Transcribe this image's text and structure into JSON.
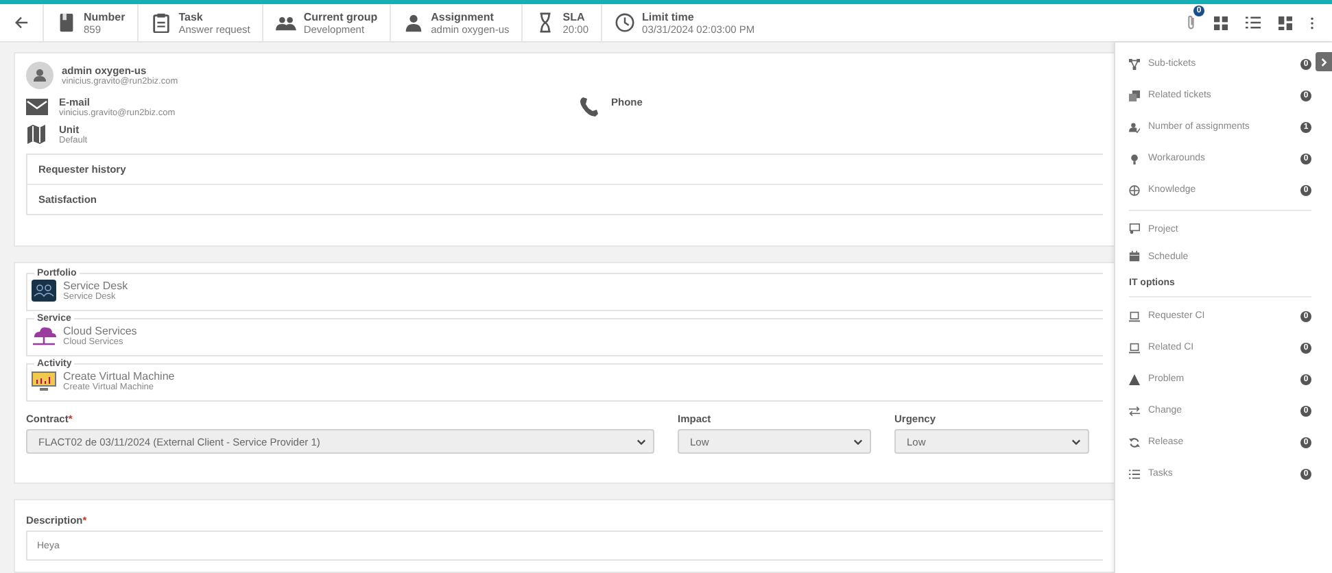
{
  "header": {
    "items": [
      {
        "label": "Number",
        "value": "859"
      },
      {
        "label": "Task",
        "value": "Answer request"
      },
      {
        "label": "Current group",
        "value": "Development"
      },
      {
        "label": "Assignment",
        "value": "admin oxygen-us"
      },
      {
        "label": "SLA",
        "value": "20:00"
      },
      {
        "label": "Limit time",
        "value": "03/31/2024 02:03:00 PM"
      }
    ],
    "attachment_count": "0"
  },
  "requester": {
    "name": "admin oxygen-us",
    "email": "vinicius.gravito@run2biz.com"
  },
  "contact": [
    {
      "label": "E-mail",
      "value": "vinicius.gravito@run2biz.com"
    },
    {
      "label": "Phone"
    },
    {
      "label": "Unit",
      "value": "Default"
    }
  ],
  "requester_sections": [
    "Requester history",
    "Satisfaction"
  ],
  "catalog": [
    {
      "label": "Portfolio",
      "title": "Service Desk",
      "subtitle": "Service Desk"
    },
    {
      "label": "Service",
      "title": "Cloud Services",
      "subtitle": "Cloud Services"
    },
    {
      "label": "Activity",
      "title": "Create Virtual Machine",
      "subtitle": "Create Virtual Machine"
    }
  ],
  "fields": [
    {
      "label": "Contract",
      "required_mark": "*",
      "value": "FLACT02 de 03/11/2024 (External Client - Service Provider 1)"
    },
    {
      "label": "Impact",
      "value": "Low"
    },
    {
      "label": "Urgency",
      "value": "Low"
    }
  ],
  "description": {
    "label": "Description",
    "required_mark": "*",
    "value": "Heya"
  },
  "side_panel": {
    "sections": [
      {
        "items": [
          {
            "label": "Sub-tickets",
            "count": "0"
          },
          {
            "label": "Related tickets",
            "count": "0"
          },
          {
            "label": "Number of assignments",
            "count": "1"
          },
          {
            "label": "Workarounds",
            "count": "0"
          },
          {
            "label": "Knowledge",
            "count": "0"
          }
        ]
      },
      {
        "items": [
          {
            "label": "Project"
          },
          {
            "label": "Schedule"
          }
        ]
      },
      {
        "heading": "IT options",
        "items": [
          {
            "label": "Requester CI",
            "count": "0"
          },
          {
            "label": "Related CI",
            "count": "0"
          },
          {
            "label": "Problem",
            "count": "0"
          },
          {
            "label": "Change",
            "count": "0"
          },
          {
            "label": "Release",
            "count": "0"
          },
          {
            "label": "Tasks",
            "count": "0"
          }
        ]
      }
    ]
  }
}
